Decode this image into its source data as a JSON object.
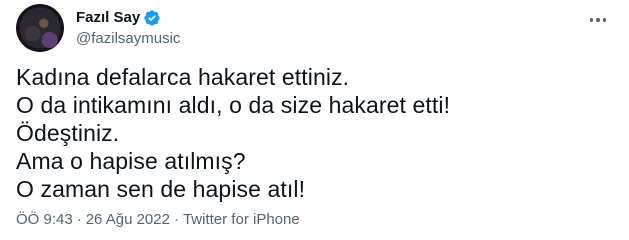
{
  "user": {
    "display_name": "Fazıl Say",
    "handle": "@fazilsaymusic",
    "verified_icon": "verified-badge-icon",
    "verified_color": "#1d9bf0"
  },
  "tweet": {
    "lines": [
      "Kadına defalarca hakaret ettiniz.",
      "O da intikamını aldı, o da size hakaret etti!",
      "Ödeştiniz.",
      "Ama o hapise atılmış?",
      "O zaman sen de hapise atıl!"
    ]
  },
  "meta": {
    "time": "ÖÖ 9:43",
    "separator": "·",
    "date": "26 Ağu 2022",
    "source": "Twitter for iPhone"
  },
  "menu": {
    "icon": "more-options-icon"
  }
}
